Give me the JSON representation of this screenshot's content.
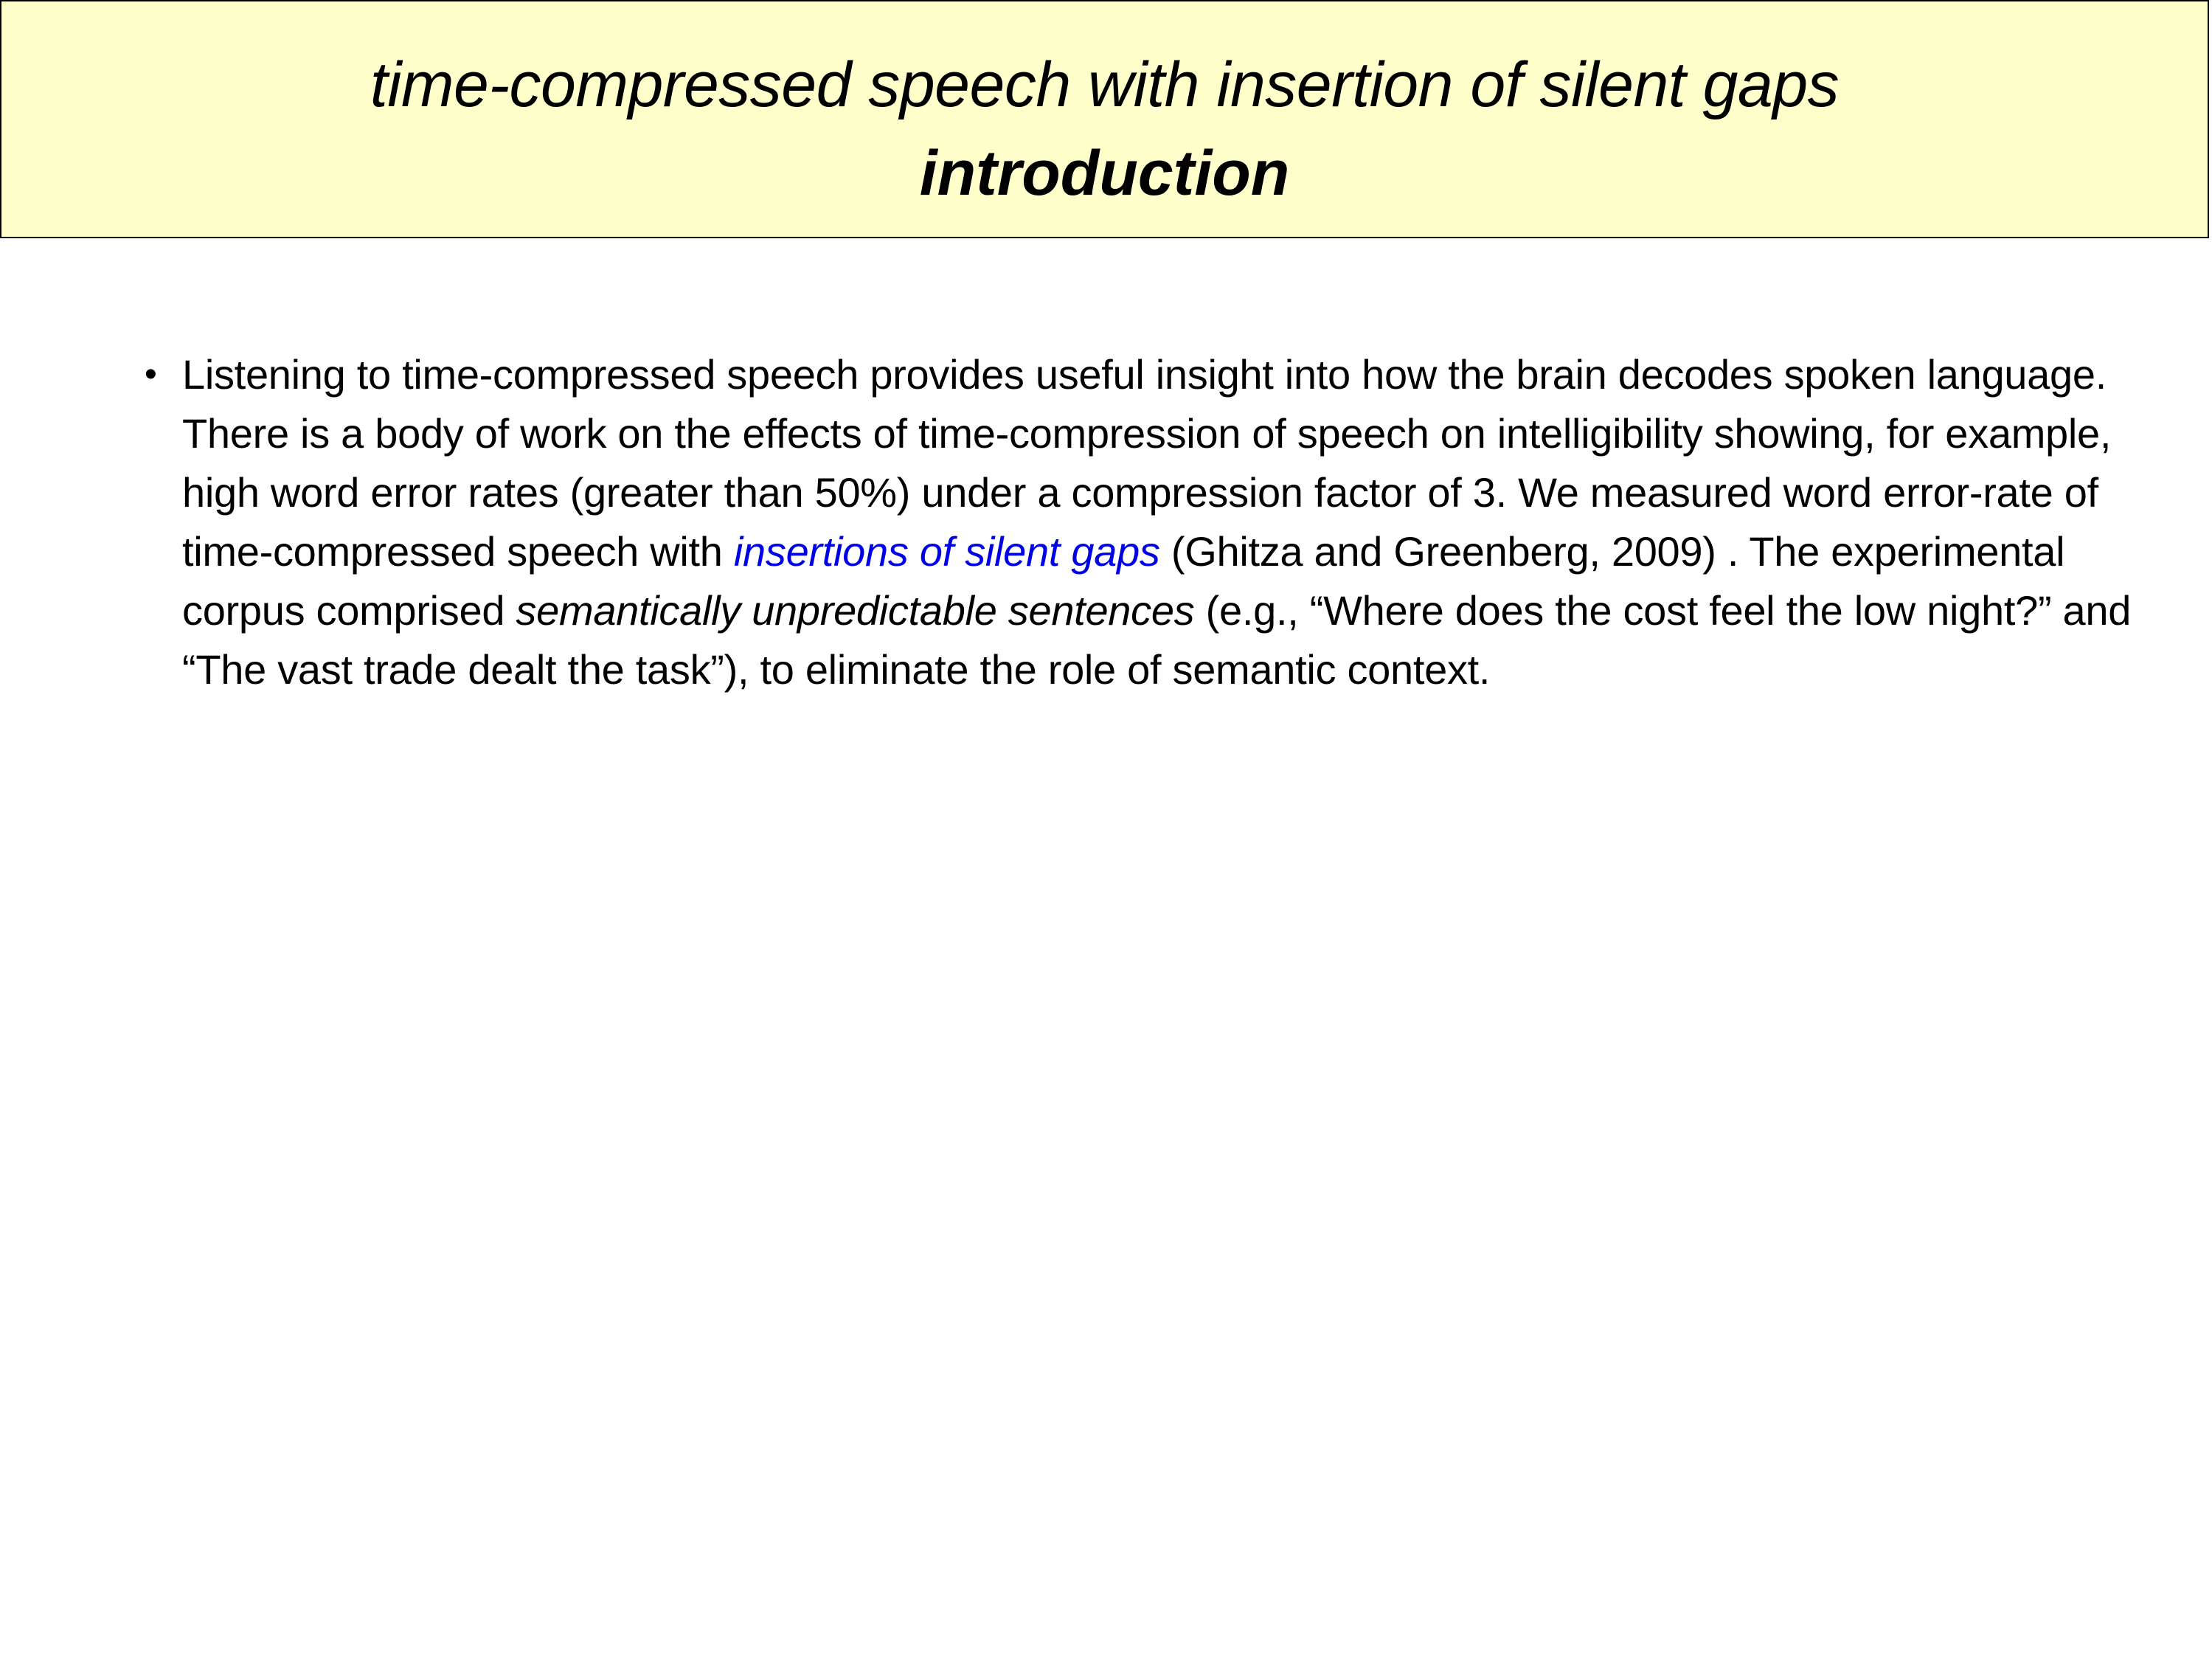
{
  "header": {
    "title_line1": "time-compressed speech with insertion of silent gaps",
    "title_line2": "introduction",
    "background_color": "#ffffcc"
  },
  "content": {
    "bullet_symbol": "•",
    "bullet_icon": "bullet-icon",
    "segments": {
      "s1": "Listening to time-compressed speech provides useful insight into how the brain decodes spoken language. There is a body of work on the effects of time-compression of speech on intelligibility showing, for example, high word error rates (greater than 50%) under a compression factor of 3. We measured word error-rate of time-compressed speech with ",
      "link_text": "insertions of silent gaps",
      "s2": " (Ghitza and Greenberg, 2009) . The experimental corpus comprised ",
      "italic_text": "semantically unpredictable sentences",
      "s3": " (e.g., “Where does the cost feel the low night?” and “The vast trade dealt the task”), to eliminate the role of semantic context."
    },
    "link_color": "#0000e6"
  }
}
